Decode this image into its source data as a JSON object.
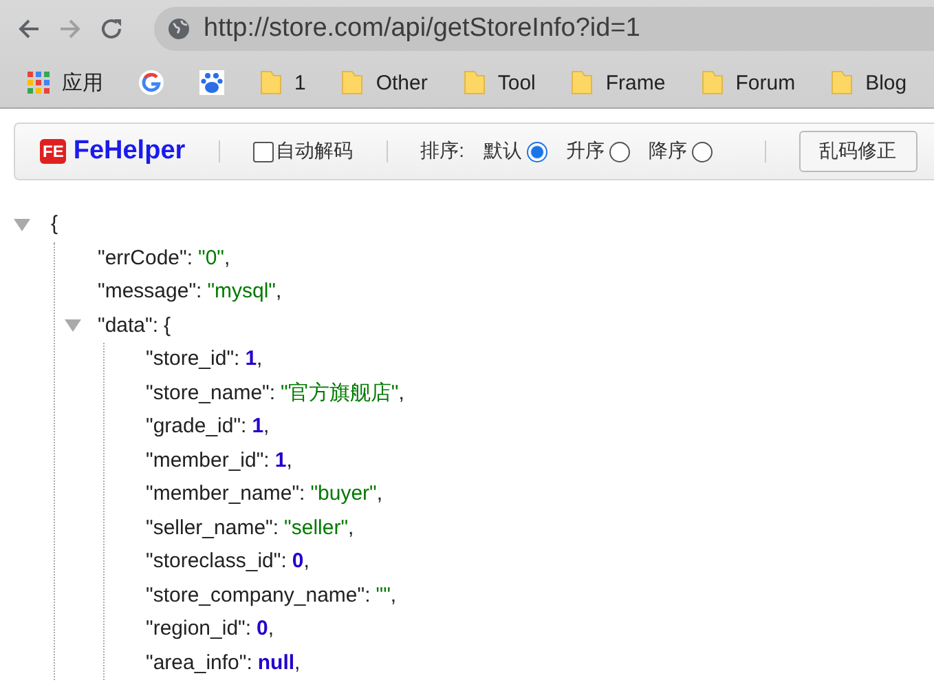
{
  "browser": {
    "url": "http://store.com/api/getStoreInfo?id=1",
    "bookmarks": [
      {
        "label": "应用",
        "kind": "apps"
      },
      {
        "kind": "google"
      },
      {
        "kind": "paw"
      },
      {
        "label": "1",
        "kind": "folder"
      },
      {
        "label": "Other",
        "kind": "folder"
      },
      {
        "label": "Tool",
        "kind": "folder"
      },
      {
        "label": "Frame",
        "kind": "folder"
      },
      {
        "label": "Forum",
        "kind": "folder"
      },
      {
        "label": "Blog",
        "kind": "folder"
      }
    ]
  },
  "toolbar": {
    "brand": "FeHelper",
    "logo": "FE",
    "auto_decode": {
      "label": "自动解码",
      "checked": false
    },
    "sort_label": "排序:",
    "sort_options": [
      {
        "label": "默认",
        "selected": true
      },
      {
        "label": "升序",
        "selected": false
      },
      {
        "label": "降序",
        "selected": false
      }
    ],
    "fix_button": "乱码修正"
  },
  "json": {
    "open": "{",
    "expanded": true,
    "children": [
      {
        "key": "\"errCode\":",
        "value": "\"0\"",
        "kind": "string",
        "punct": ","
      },
      {
        "key": "\"message\":",
        "value": "\"mysql\"",
        "kind": "string",
        "punct": ","
      },
      {
        "key": "\"data\":",
        "value": "{",
        "kind": "object",
        "expanded": true,
        "children": [
          {
            "key": "\"store_id\":",
            "value": "1",
            "kind": "number",
            "punct": ","
          },
          {
            "key": "\"store_name\":",
            "value": "\"官方旗舰店\"",
            "kind": "string",
            "punct": ","
          },
          {
            "key": "\"grade_id\":",
            "value": "1",
            "kind": "number",
            "punct": ","
          },
          {
            "key": "\"member_id\":",
            "value": "1",
            "kind": "number",
            "punct": ","
          },
          {
            "key": "\"member_name\":",
            "value": "\"buyer\"",
            "kind": "string",
            "punct": ","
          },
          {
            "key": "\"seller_name\":",
            "value": "\"seller\"",
            "kind": "string",
            "punct": ","
          },
          {
            "key": "\"storeclass_id\":",
            "value": "0",
            "kind": "number",
            "punct": ","
          },
          {
            "key": "\"store_company_name\":",
            "value": "\"\"",
            "kind": "string",
            "punct": ","
          },
          {
            "key": "\"region_id\":",
            "value": "0",
            "kind": "number",
            "punct": ","
          },
          {
            "key": "\"area_info\":",
            "value": "null",
            "kind": "null",
            "punct": ","
          }
        ]
      }
    ]
  }
}
